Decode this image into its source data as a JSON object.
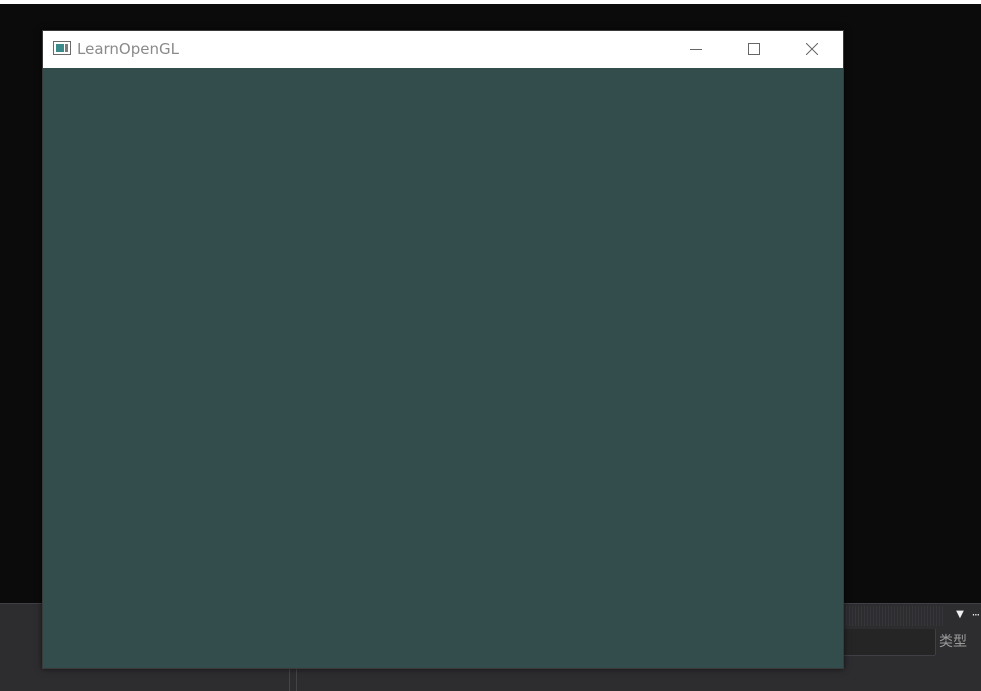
{
  "window": {
    "title": "LearnOpenGL",
    "clear_color": "#334d4d",
    "icon": "app-window-icon"
  },
  "title_bar": {
    "minimize_icon": "minimize-icon",
    "maximize_icon": "maximize-icon",
    "close_icon": "close-icon"
  },
  "ide_panel": {
    "column_header": "类型",
    "dropdown_icon": "chevron-down-icon",
    "pin_icon": "pin-icon"
  }
}
